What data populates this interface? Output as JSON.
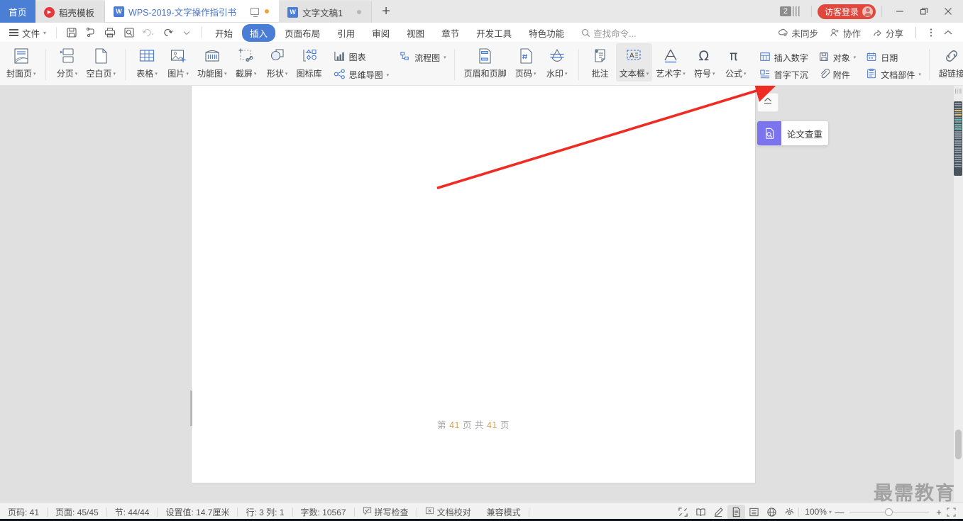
{
  "window": {
    "home_tab": "首页",
    "tabs": [
      {
        "label": "稻壳模板",
        "icon": "dao-ke-icon",
        "active": false,
        "type": "docer"
      },
      {
        "label": "WPS-2019-文字操作指引书",
        "icon": "wps-writer-icon",
        "active": true,
        "type": "writer"
      },
      {
        "label": "文字文稿1",
        "icon": "wps-writer-icon",
        "active": false,
        "type": "writer"
      }
    ],
    "new_tab_label": "+",
    "count_badge": "2",
    "login_label": "访客登录",
    "minimize": "—",
    "restore": "❐",
    "close": "✕"
  },
  "menubar": {
    "file_label": "文件",
    "quick_access": [
      "save-icon",
      "save-as-icon",
      "print-icon",
      "print-preview-icon",
      "undo-icon",
      "redo-icon",
      "customize-icon"
    ],
    "tabs": [
      {
        "label": "开始",
        "active": false
      },
      {
        "label": "插入",
        "active": true
      },
      {
        "label": "页面布局",
        "active": false
      },
      {
        "label": "引用",
        "active": false
      },
      {
        "label": "审阅",
        "active": false
      },
      {
        "label": "视图",
        "active": false
      },
      {
        "label": "章节",
        "active": false
      },
      {
        "label": "开发工具",
        "active": false
      },
      {
        "label": "特色功能",
        "active": false
      }
    ],
    "search_placeholder": "查找命令...",
    "right_items": [
      {
        "label": "未同步",
        "icon": "cloud-sync-icon"
      },
      {
        "label": "协作",
        "icon": "collaborate-icon"
      },
      {
        "label": "分享",
        "icon": "share-icon"
      }
    ],
    "more_icon": "more-vertical-icon",
    "collapse_icon": "chevron-up-icon"
  },
  "ribbon": {
    "groups": [
      {
        "items": [
          {
            "label": "封面页",
            "icon": "cover-page-icon",
            "dropdown": true,
            "selected": false
          }
        ]
      },
      {
        "items": [
          {
            "label": "分页",
            "icon": "page-break-icon",
            "dropdown": true,
            "selected": false
          },
          {
            "label": "空白页",
            "icon": "blank-page-icon",
            "dropdown": true,
            "selected": false
          }
        ]
      },
      {
        "items": [
          {
            "label": "表格",
            "icon": "table-icon",
            "dropdown": true,
            "selected": false
          },
          {
            "label": "图片",
            "icon": "picture-icon",
            "dropdown": true,
            "selected": false
          },
          {
            "label": "功能图",
            "icon": "function-chart-icon",
            "dropdown": true,
            "selected": false
          },
          {
            "label": "截屏",
            "icon": "screenshot-icon",
            "dropdown": true,
            "selected": false
          },
          {
            "label": "形状",
            "icon": "shapes-icon",
            "dropdown": true,
            "selected": false
          },
          {
            "label": "图标库",
            "icon": "icon-library-icon",
            "dropdown": false,
            "selected": false
          }
        ]
      },
      {
        "stacked": [
          {
            "label": "图表",
            "icon": "chart-icon",
            "dropdown": false
          },
          {
            "label": "思维导图",
            "icon": "mindmap-icon",
            "dropdown": true
          }
        ]
      },
      {
        "stacked": [
          {
            "label": "流程图",
            "icon": "flowchart-icon",
            "dropdown": true
          }
        ]
      },
      {
        "items": [
          {
            "label": "页眉和页脚",
            "icon": "header-footer-icon",
            "dropdown": false,
            "selected": false
          },
          {
            "label": "页码",
            "icon": "page-number-icon",
            "dropdown": true,
            "selected": false
          },
          {
            "label": "水印",
            "icon": "watermark-icon",
            "dropdown": true,
            "selected": false
          }
        ]
      },
      {
        "items": [
          {
            "label": "批注",
            "icon": "comment-icon",
            "dropdown": false,
            "selected": false
          },
          {
            "label": "文本框",
            "icon": "textbox-icon",
            "dropdown": true,
            "selected": true
          },
          {
            "label": "艺术字",
            "icon": "wordart-icon",
            "dropdown": true,
            "selected": false
          },
          {
            "label": "符号",
            "icon": "symbol-icon",
            "dropdown": true,
            "selected": false
          },
          {
            "label": "公式",
            "icon": "formula-icon",
            "dropdown": true,
            "selected": false
          }
        ]
      },
      {
        "stacked2": [
          {
            "label": "插入数字",
            "icon": "insert-number-icon",
            "dropdown": false
          },
          {
            "label": "首字下沉",
            "icon": "drop-cap-icon",
            "dropdown": false
          }
        ]
      },
      {
        "stacked2": [
          {
            "label": "对象",
            "icon": "object-icon",
            "dropdown": true
          },
          {
            "label": "附件",
            "icon": "attachment-icon",
            "dropdown": false
          }
        ]
      },
      {
        "stacked2": [
          {
            "label": "日期",
            "icon": "date-icon",
            "dropdown": false
          },
          {
            "label": "文档部件",
            "icon": "doc-parts-icon",
            "dropdown": true
          }
        ]
      },
      {
        "items": [
          {
            "label": "超链接",
            "icon": "hyperlink-icon",
            "dropdown": false,
            "selected": false
          }
        ]
      }
    ],
    "expand_icon": "chevron-right-icon"
  },
  "document": {
    "footer_prefix": "第",
    "footer_page": "41",
    "footer_mid": "页  共",
    "footer_total": "41",
    "footer_suffix": "页"
  },
  "sidepanel": {
    "eject_icon": "eject-icon",
    "card": {
      "label": "论文查重",
      "icon": "paper-check-icon"
    }
  },
  "statusbar": {
    "left_items": [
      "页码: 41",
      "页面: 45/45",
      "节: 44/44",
      "设置值: 14.7厘米",
      "行: 3   列: 1",
      "字数: 10567"
    ],
    "spell_check": "拼写检查",
    "doc_proof": "文档校对",
    "compat_mode": "兼容模式",
    "view_buttons": [
      {
        "icon": "fullscreen-icon",
        "active": false
      },
      {
        "icon": "book-reading-icon",
        "active": false
      },
      {
        "icon": "pen-edit-icon",
        "active": false
      },
      {
        "icon": "page-view-icon",
        "active": true
      },
      {
        "icon": "outline-view-icon",
        "active": false
      },
      {
        "icon": "web-view-icon",
        "active": false
      },
      {
        "icon": "eye-protect-icon",
        "active": false
      }
    ],
    "zoom_label": "100%",
    "zoom_minus": "—",
    "zoom_plus": "+",
    "fullscreen_icon": "expand-corner-icon"
  },
  "watermark": "最需教育",
  "colors": {
    "accent_blue": "#4a7ed6",
    "home_tab_blue": "#4b7fd6",
    "login_red": "#e0483e",
    "card_purple": "#7b74ee",
    "arrow_red": "#ef2b23"
  }
}
